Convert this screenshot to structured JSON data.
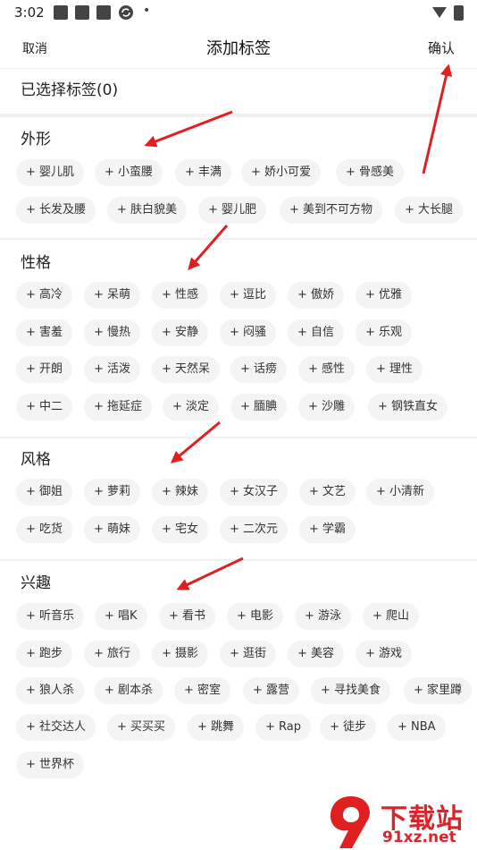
{
  "status": {
    "time": "3:02",
    "dot": "•"
  },
  "header": {
    "cancel": "取消",
    "title": "添加标签",
    "confirm": "确认"
  },
  "selected": {
    "label": "已选择标签(0)"
  },
  "sections": [
    {
      "title": "外形",
      "tags": [
        "+ 婴儿肌",
        "+ 小蛮腰",
        "+ 丰满",
        "+ 娇小可爱",
        "+ 骨感美",
        "+ 长发及腰",
        "+ 肤白貌美",
        "+ 婴儿肥",
        "+ 美到不可方物",
        "+ 大长腿"
      ]
    },
    {
      "title": "性格",
      "tags": [
        "+ 高冷",
        "+ 呆萌",
        "+ 性感",
        "+ 逗比",
        "+ 傲娇",
        "+ 优雅",
        "+ 害羞",
        "+ 慢热",
        "+ 安静",
        "+ 闷骚",
        "+ 自信",
        "+ 乐观",
        "+ 开朗",
        "+ 活泼",
        "+ 天然呆",
        "+ 话痨",
        "+ 感性",
        "+ 理性",
        "+ 中二",
        "+ 拖延症",
        "+ 淡定",
        "+ 腼腆",
        "+ 沙雕",
        "+ 钢铁直女"
      ]
    },
    {
      "title": "风格",
      "tags": [
        "+ 御姐",
        "+ 萝莉",
        "+ 辣妹",
        "+ 女汉子",
        "+ 文艺",
        "+ 小清新",
        "+ 吃货",
        "+ 萌妹",
        "+ 宅女",
        "+ 二次元",
        "+ 学霸"
      ]
    },
    {
      "title": "兴趣",
      "tags": [
        "+ 听音乐",
        "+ 唱K",
        "+ 看书",
        "+ 电影",
        "+ 游泳",
        "+ 爬山",
        "+ 跑步",
        "+ 旅行",
        "+ 摄影",
        "+ 逛街",
        "+ 美容",
        "+ 游戏",
        "+ 狼人杀",
        "+ 剧本杀",
        "+ 密室",
        "+ 露营",
        "+ 寻找美食",
        "+ 家里蹲",
        "+ 社交达人",
        "+ 买买买",
        "+ 跳舞",
        "+ Rap",
        "+ 徒步",
        "+ NBA",
        "+ 世界杯"
      ]
    }
  ],
  "watermark": {
    "brand": "下载站",
    "domain": "91xz.net"
  },
  "colors": {
    "accent": "#e02020",
    "tag_bg": "#f4f4f4",
    "divider": "#f0f0f0"
  }
}
